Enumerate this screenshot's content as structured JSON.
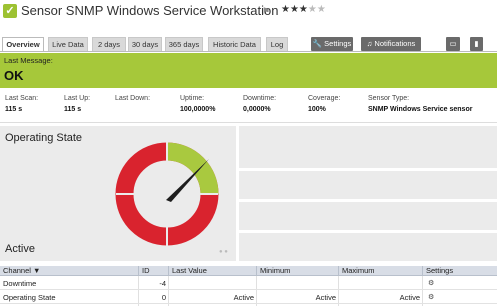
{
  "header": {
    "title": "Sensor SNMP Windows Service Workstation",
    "status_icon": "check-icon",
    "status_color": "#9dc232",
    "priority_stars_filled": 3,
    "priority_stars_total": 5,
    "stars_filled_text": "★★★",
    "stars_empty_text": "★★"
  },
  "tabs": {
    "items": [
      {
        "label": "Overview",
        "active": true
      },
      {
        "label": "Live Data"
      },
      {
        "label": "2 days"
      },
      {
        "label": "30 days"
      },
      {
        "label": "365 days"
      },
      {
        "label": "Historic Data"
      },
      {
        "label": "Log"
      }
    ],
    "settings_label": "Settings",
    "notifications_label": "Notifications"
  },
  "message": {
    "label": "Last Message:",
    "value": "OK",
    "color": "#a6c83a"
  },
  "stats": {
    "last_scan_label": "Last Scan:",
    "last_scan_value": "115 s",
    "last_up_label": "Last Up:",
    "last_up_value": "115 s",
    "last_down_label": "Last Down:",
    "last_down_value": "",
    "uptime_label": "Uptime:",
    "uptime_value": "100,0000%",
    "downtime_label": "Downtime:",
    "downtime_value": "0,0000%",
    "coverage_label": "Coverage:",
    "coverage_value": "100%",
    "sensor_type_label": "Sensor Type:",
    "sensor_type_value": "SNMP Windows Service sensor"
  },
  "gauge": {
    "title": "Operating State",
    "footer": "Active",
    "ok_color": "#a9c93f",
    "error_color": "#d9232e"
  },
  "table": {
    "headers": {
      "channel": "Channel",
      "id": "ID",
      "last_value": "Last Value",
      "minimum": "Minimum",
      "maximum": "Maximum",
      "settings": "Settings"
    },
    "rows": [
      {
        "channel": "Downtime",
        "id": "-4",
        "last_value": "",
        "minimum": "",
        "maximum": ""
      },
      {
        "channel": "Operating State",
        "id": "0",
        "last_value": "Active",
        "minimum": "Active",
        "maximum": "Active"
      }
    ]
  }
}
